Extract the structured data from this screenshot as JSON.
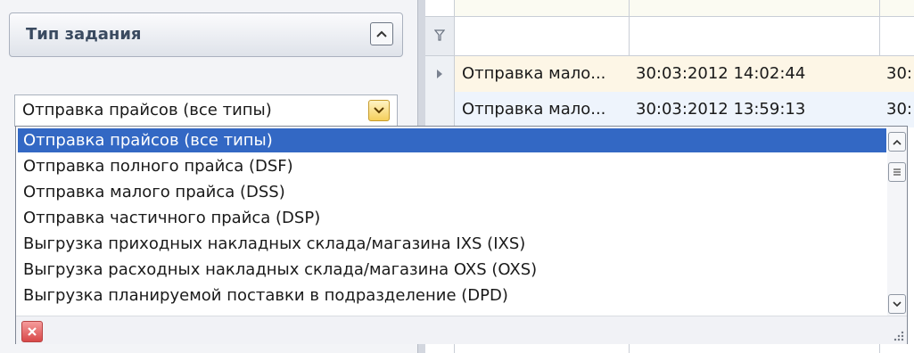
{
  "panel": {
    "title": "Тип задания"
  },
  "combo": {
    "value": "Отправка прайсов (все типы)"
  },
  "grid": {
    "rows": [
      {
        "type": "Отправка мало...",
        "date": "30:03:2012 14:02:44",
        "extra": "30:"
      },
      {
        "type": "Отправка мало...",
        "date": "30:03:2012 13:59:13",
        "extra": "30:"
      }
    ]
  },
  "dropdown": {
    "items": [
      "Отправка прайсов (все типы)",
      "Отправка полного прайса (DSF)",
      "Отправка малого прайса (DSS)",
      "Отправка частичного прайса  (DSP)",
      "Выгрузка приходных накладных склада/магазина IXS (IXS)",
      "Выгрузка расходных накладных склада/магазина OXS (OXS)",
      "Выгрузка планируемой поставки в подразделение (DPD)"
    ],
    "selected_index": 0
  },
  "colors": {
    "selection": "#3368c4",
    "delete": "#d84848",
    "combo_button": "#f5cf5c"
  },
  "icons": [
    "chevron-up-icon",
    "chevron-down-icon",
    "filter-icon",
    "row-pointer-icon",
    "scroll-thumb-icon",
    "delete-x-icon",
    "resize-grip-icon"
  ]
}
